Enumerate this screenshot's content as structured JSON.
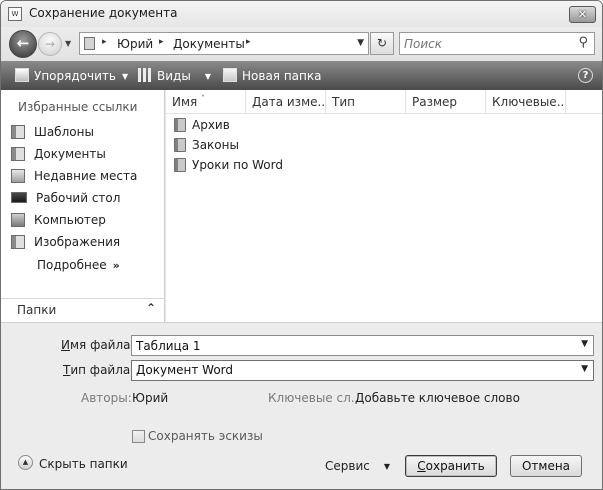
{
  "window": {
    "title": "Сохранение документа",
    "close_glyph": "✕"
  },
  "address": {
    "parts": [
      "Юрий",
      "Документы"
    ],
    "separator": "▸",
    "search_placeholder": "Поиск"
  },
  "toolbar": {
    "organize_label": "Упорядочить",
    "views_label": "Виды",
    "new_folder_label": "Новая папка",
    "help_glyph": "?"
  },
  "sidebar": {
    "favorites_heading": "Избранные ссылки",
    "items": [
      {
        "label": "Шаблоны",
        "icon": "templates-icon"
      },
      {
        "label": "Документы",
        "icon": "documents-icon"
      },
      {
        "label": "Недавние места",
        "icon": "recent-places-icon"
      },
      {
        "label": "Рабочий стол",
        "icon": "desktop-icon"
      },
      {
        "label": "Компьютер",
        "icon": "computer-icon"
      },
      {
        "label": "Изображения",
        "icon": "pictures-icon"
      }
    ],
    "more_label": "Подробнее",
    "folders_label": "Папки"
  },
  "filelist": {
    "columns": [
      "Имя",
      "Дата изме...",
      "Тип",
      "Размер",
      "Ключевые..."
    ],
    "items": [
      "Архив",
      "Законы",
      "Уроки по Word"
    ]
  },
  "form": {
    "filename_label_u": "И",
    "filename_label_rest": "мя файла:",
    "filename_value": "Таблица 1",
    "filetype_label_u": "Т",
    "filetype_label_rest": "ип файла:",
    "filetype_value": "Документ Word",
    "authors_label": "Авторы:",
    "authors_value": "Юрий",
    "keywords_label": "Ключевые сл...",
    "keywords_value": "Добавьте ключевое слово",
    "thumbnails_label": "Сохранять эскизы"
  },
  "footer": {
    "hide_folders_label": "Скрыть папки",
    "service_label": "Сервис",
    "save_label_u": "С",
    "save_label_rest": "охранить",
    "cancel_label": "Отмена"
  }
}
